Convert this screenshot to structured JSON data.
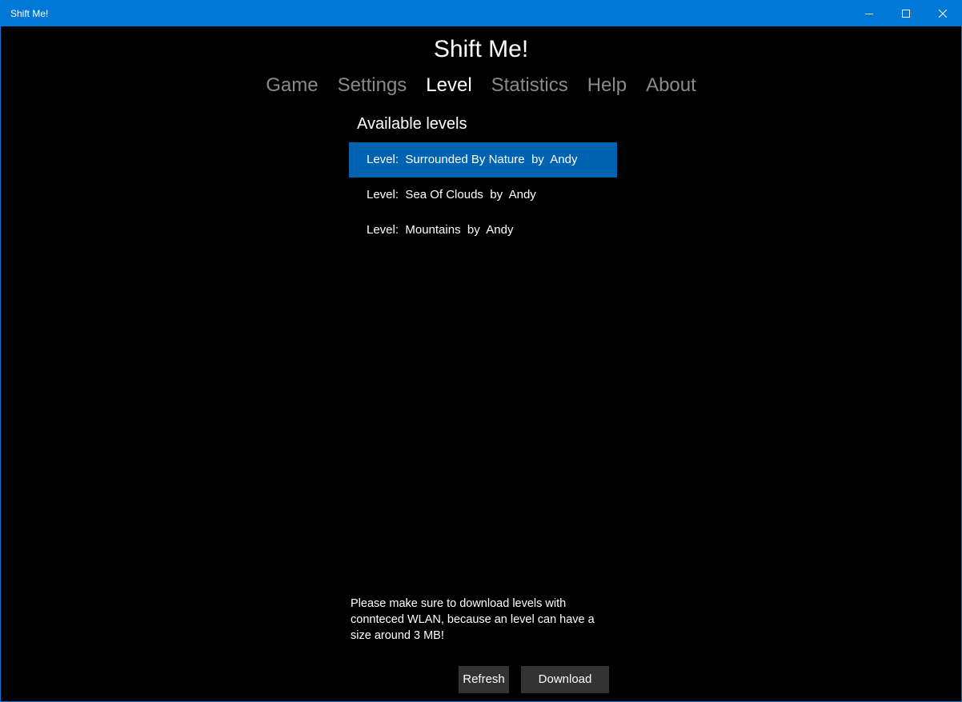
{
  "window": {
    "title": "Shift Me!"
  },
  "app": {
    "title": "Shift Me!"
  },
  "nav": {
    "items": [
      {
        "label": "Game",
        "active": false
      },
      {
        "label": "Settings",
        "active": false
      },
      {
        "label": "Level",
        "active": true
      },
      {
        "label": "Statistics",
        "active": false
      },
      {
        "label": "Help",
        "active": false
      },
      {
        "label": "About",
        "active": false
      }
    ]
  },
  "levels": {
    "heading": "Available levels",
    "items": [
      {
        "label": "Level:  Surrounded By Nature  by  Andy",
        "selected": true
      },
      {
        "label": "Level:  Sea Of Clouds  by  Andy",
        "selected": false
      },
      {
        "label": "Level:  Mountains  by  Andy",
        "selected": false
      }
    ]
  },
  "notice": "Please make sure to download levels with connteced WLAN, because an level can have a size around 3 MB!",
  "buttons": {
    "refresh": "Refresh",
    "download": "Download"
  },
  "colors": {
    "accent": "#0078d7",
    "selection": "#0063b1",
    "background": "#000000",
    "nav_inactive": "#8a8a8a",
    "button_bg": "#333333"
  },
  "icons": {
    "minimize": "minimize-icon",
    "maximize": "maximize-icon",
    "close": "close-icon"
  }
}
